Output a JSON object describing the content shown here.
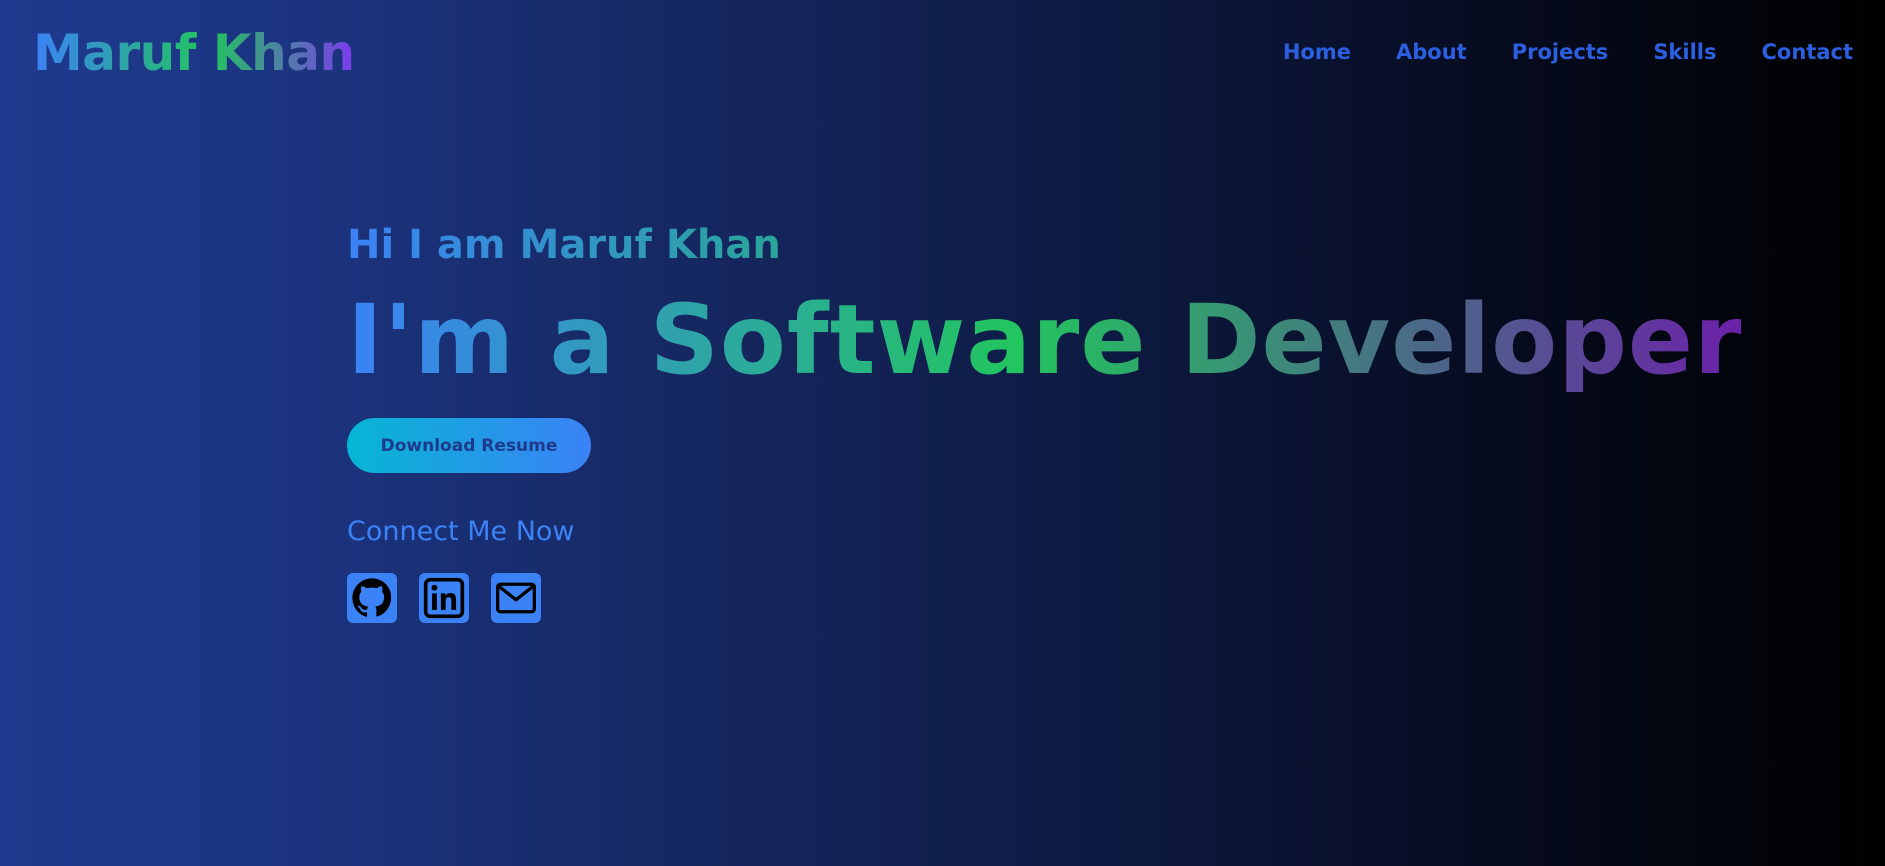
{
  "brand": {
    "name": "Maruf Khan"
  },
  "nav": {
    "items": [
      {
        "label": "Home"
      },
      {
        "label": "About"
      },
      {
        "label": "Projects"
      },
      {
        "label": "Skills"
      },
      {
        "label": "Contact"
      }
    ]
  },
  "hero": {
    "greeting": "Hi I am Maruf Khan",
    "headline": "I'm a Software Developer",
    "resume_button": "Download Resume",
    "connect_label": "Connect Me Now",
    "socials": [
      {
        "icon": "github-icon"
      },
      {
        "icon": "linkedin-icon"
      },
      {
        "icon": "mail-icon"
      }
    ]
  },
  "colors": {
    "accent_blue": "#3b82f6",
    "accent_green": "#22c55e",
    "accent_purple": "#6b21a8",
    "accent_cyan": "#06b6d4",
    "nav_link": "#2c5fe0",
    "background_left": "#1f3a8e",
    "background_right": "#000000"
  }
}
